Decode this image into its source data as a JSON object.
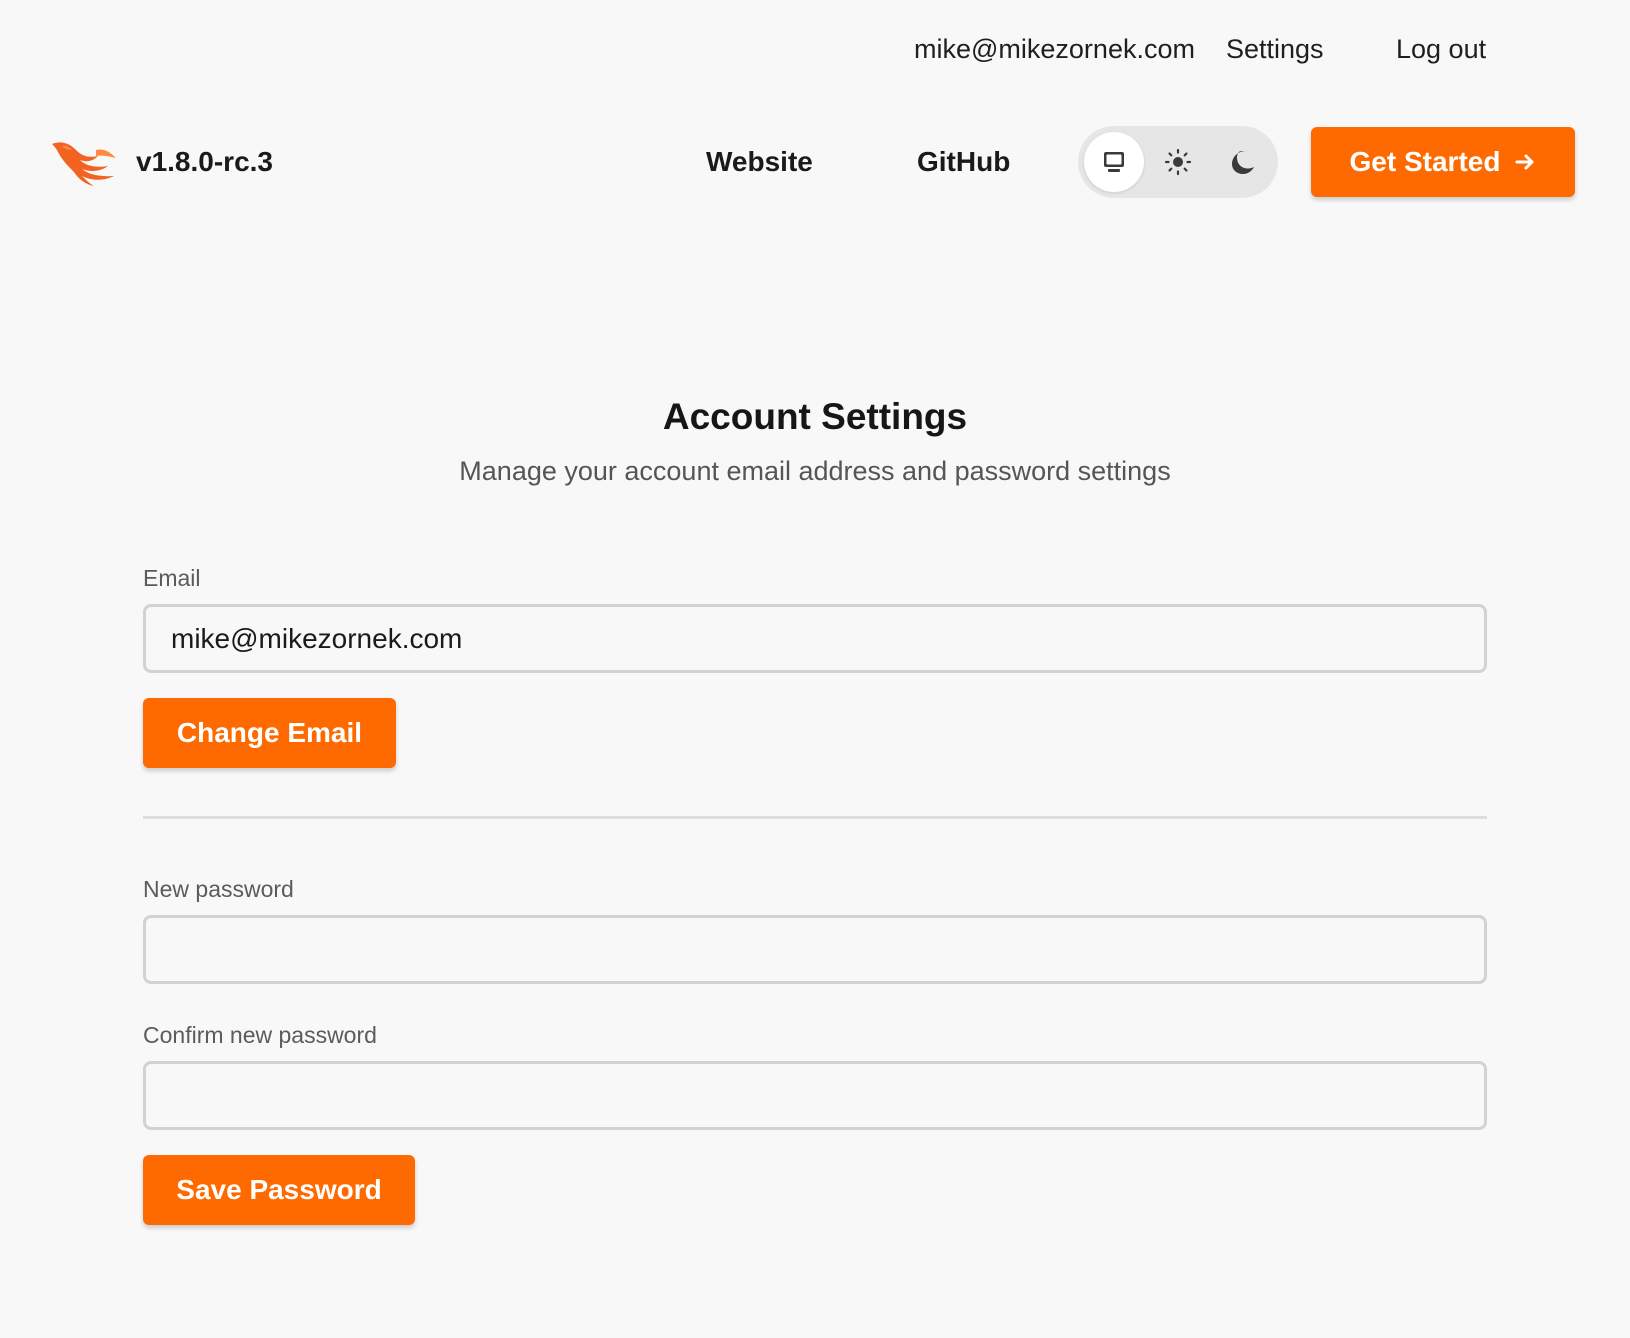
{
  "user_bar": {
    "email": "mike@mikezornek.com",
    "settings_label": "Settings",
    "logout_label": "Log out"
  },
  "header": {
    "logo_icon": "phoenix-logo-icon",
    "version": "v1.8.0-rc.3",
    "nav": {
      "website_label": "Website",
      "github_label": "GitHub"
    },
    "theme_toggle": {
      "options": [
        "system-icon",
        "sun-icon",
        "moon-icon"
      ],
      "selected": "system"
    },
    "cta_label": "Get Started",
    "cta_icon": "arrow-right-icon"
  },
  "main": {
    "title": "Account Settings",
    "subtitle": "Manage your account email address and password settings",
    "email_form": {
      "label": "Email",
      "value": "mike@mikezornek.com",
      "submit_label": "Change Email"
    },
    "password_form": {
      "new_password_label": "New password",
      "confirm_password_label": "Confirm new password",
      "submit_label": "Save Password"
    }
  },
  "colors": {
    "accent": "#ff6a00",
    "background": "#f8f8f8"
  }
}
